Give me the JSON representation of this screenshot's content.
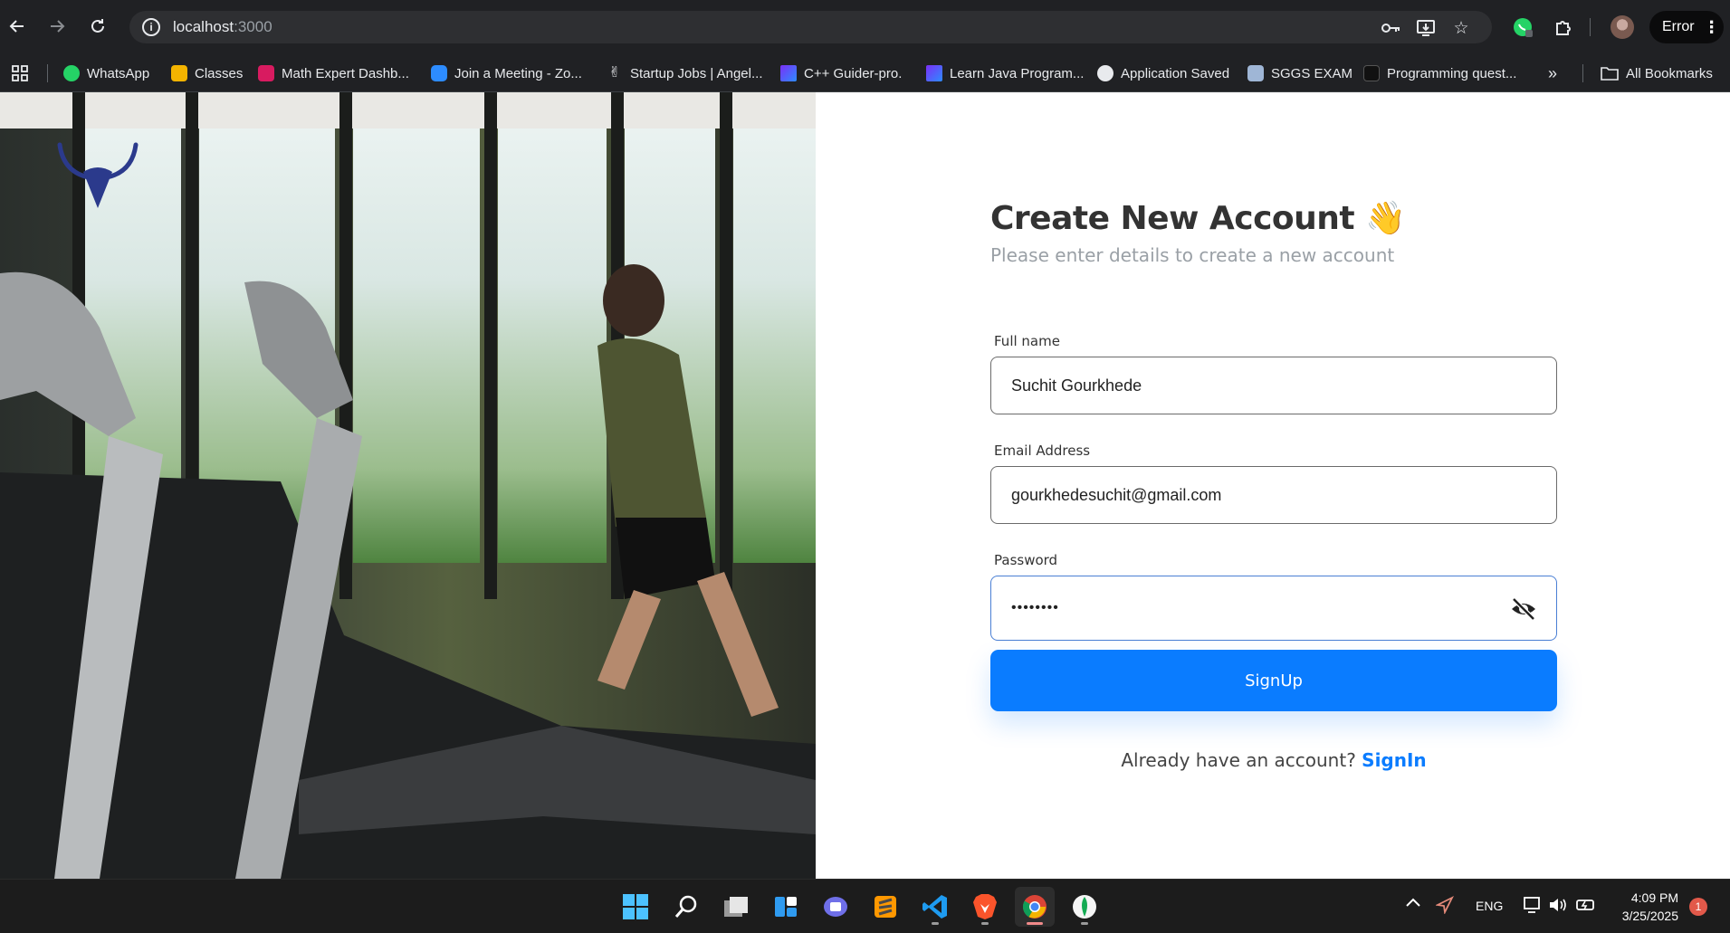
{
  "browser": {
    "url_host": "localhost",
    "url_port": ":3000",
    "profile_error_label": "Error",
    "bookmarks": [
      {
        "label": "WhatsApp",
        "color": "#25d366"
      },
      {
        "label": "Classes",
        "color": "#f4b400"
      },
      {
        "label": "Math Expert Dashb...",
        "color": "#d81b60"
      },
      {
        "label": "Join a Meeting - Zo...",
        "color": "#2d8cff"
      },
      {
        "label": "Startup Jobs | Angel...",
        "color": "#e8eaed"
      },
      {
        "label": "C++ Guider-pro.",
        "color": "#7b2ff7"
      },
      {
        "label": "Learn Java Program...",
        "color": "#7b2ff7"
      },
      {
        "label": "Application Saved",
        "color": "#e8eaed"
      },
      {
        "label": "SGGS EXAM",
        "color": "#9fb6d6"
      },
      {
        "label": "Programming quest...",
        "color": "#111111"
      }
    ],
    "all_bookmarks_label": "All Bookmarks"
  },
  "form": {
    "title": "Create New Account",
    "title_emoji": "👋",
    "subtitle": "Please enter details to create a new account",
    "fields": [
      {
        "label": "Full name",
        "value": "Suchit Gourkhede"
      },
      {
        "label": "Email Address",
        "value": "gourkhedesuchit@gmail.com"
      },
      {
        "label": "Password",
        "value": "••••••••"
      }
    ],
    "submit_label": "SignUp",
    "signin_prompt": "Already have an account?",
    "signin_link": "SignIn"
  },
  "taskbar": {
    "language": "ENG",
    "time": "4:09 PM",
    "date": "3/25/2025",
    "notification_count": "1"
  },
  "colors": {
    "primary": "#0a7cff",
    "chrome_bg": "#202124",
    "taskbar_bg": "#1c1c1c"
  }
}
